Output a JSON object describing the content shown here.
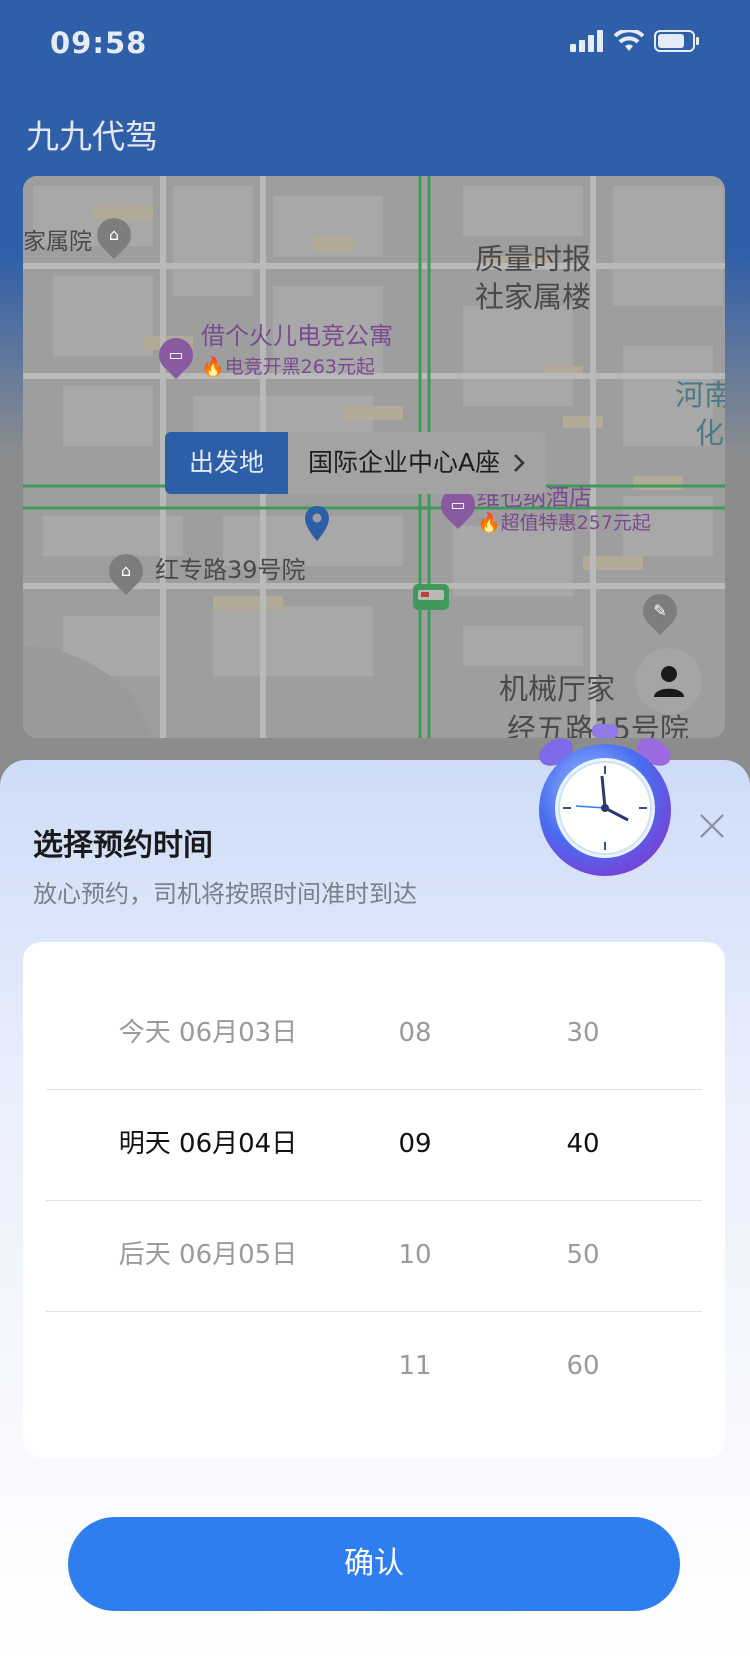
{
  "status_bar": {
    "time": "09:58"
  },
  "app": {
    "title": "九九代驾"
  },
  "map": {
    "labels": {
      "poi_family_courtyard": "家属院",
      "poi_building_1": "质量时报",
      "poi_building_2": "社家属楼",
      "poi_apartment": "借个火儿电竞公寓",
      "poi_apartment_promo": "电竞开黑263元起",
      "poi_river_1": "河南",
      "poi_river_2": "化",
      "poi_hotel": "维也纳酒店",
      "poi_hotel_promo": "超值特惠257元起",
      "poi_road_courtyard": "红专路39号院",
      "poi_machinery_1": "机械厅家",
      "poi_machinery_2": "经五路15号院"
    },
    "origin": {
      "label": "出发地",
      "place": "国际企业中心A座"
    }
  },
  "sheet": {
    "title": "选择预约时间",
    "subtitle": "放心预约，司机将按照时间准时到达"
  },
  "picker": {
    "rows": [
      {
        "day": "今天 06月03日",
        "hour": "08",
        "minute": "30"
      },
      {
        "day": "明天 06月04日",
        "hour": "09",
        "minute": "40"
      },
      {
        "day": "后天 06月05日",
        "hour": "10",
        "minute": "50"
      },
      {
        "day": "",
        "hour": "11",
        "minute": "60"
      }
    ],
    "selected_index": 1
  },
  "confirm": {
    "label": "确认"
  },
  "colors": {
    "primary": "#2e7ef0",
    "header": "#2f5fa8"
  }
}
